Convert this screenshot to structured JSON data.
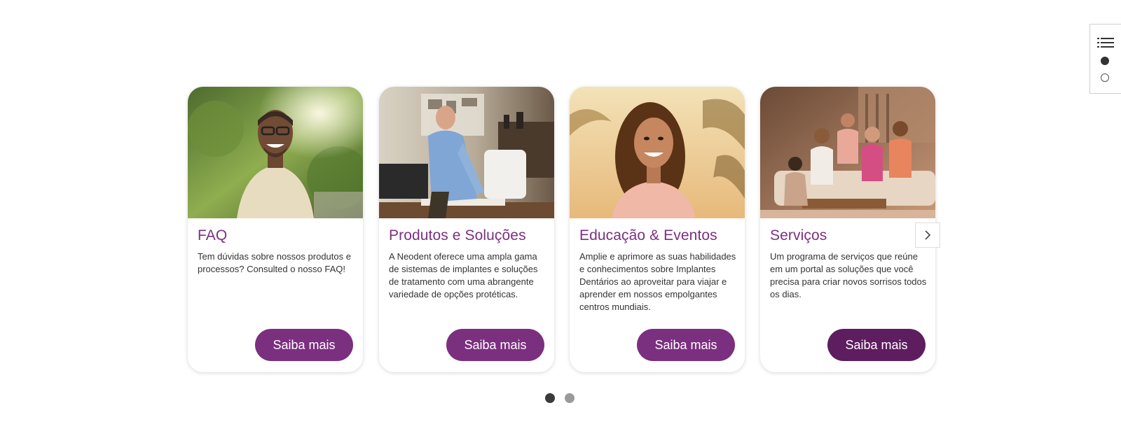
{
  "cards": [
    {
      "title": "FAQ",
      "description": "Tem dúvidas sobre nossos produtos e processos? Consulted o nosso FAQ!",
      "button": "Saiba mais",
      "image": "smiling-man-with-glasses-outdoors"
    },
    {
      "title": "Produtos e Soluções",
      "description": "A Neodent oferece uma ampla gama de sistemas de implantes e soluções de tratamento com uma abrangente variedade de opções protéticas.",
      "button": "Saiba mais",
      "image": "man-working-at-desk"
    },
    {
      "title": "Educação & Eventos",
      "description": "Amplie e aprimore as suas habilidades e conhecimentos sobre Implantes Dentários ao aproveitar para viajar e aprender em nossos empolgantes centros mundiais.",
      "button": "Saiba mais",
      "image": "smiling-woman-palm-trees"
    },
    {
      "title": "Serviços",
      "description": "Um programa de serviços que reúne em um portal as soluções que você precisa para criar novos sorrisos todos os dias.",
      "button": "Saiba mais",
      "image": "group-of-friends-on-sofa"
    }
  ],
  "carousel": {
    "next_icon": "chevron-right-icon",
    "pagination": {
      "pages": 2,
      "active": 1
    }
  },
  "side_nav": {
    "menu_icon": "list-icon",
    "sections": 2,
    "active": 1
  },
  "colors": {
    "brand_purple": "#7b2f7f",
    "hover_purple": "#5d1d5f",
    "dot_active": "#3a3a3a",
    "dot_inactive": "#9a9a9a"
  }
}
